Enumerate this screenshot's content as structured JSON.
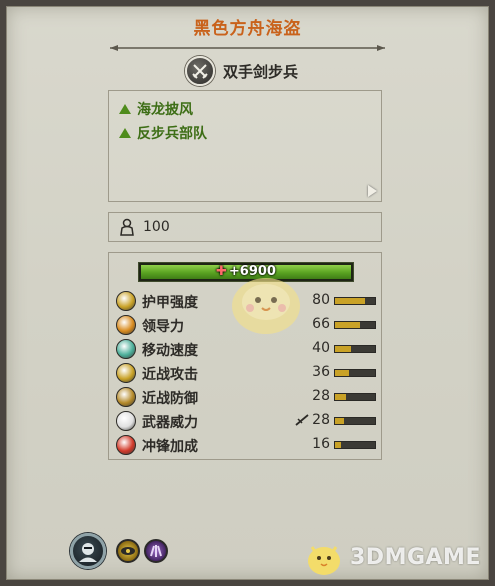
{
  "faction_title": "黑色方舟海盗",
  "unit": {
    "name": "双手剑步兵",
    "icon": "crossed-swords-icon"
  },
  "abilities": [
    {
      "label": "海龙披风",
      "icon": "green-triangle-icon"
    },
    {
      "label": "反步兵部队",
      "icon": "green-triangle-icon"
    }
  ],
  "men": {
    "count": "100",
    "icon": "soldier-icon"
  },
  "health": {
    "label": "+6900",
    "fraction": 1.0
  },
  "stats": [
    {
      "label": "护甲强度",
      "value": "80",
      "fill": 0.75,
      "icon": "armor-icon",
      "color": "#c9a227"
    },
    {
      "label": "领导力",
      "value": "66",
      "fill": 0.62,
      "icon": "leadership-icon",
      "color": "#d98b1e"
    },
    {
      "label": "移动速度",
      "value": "40",
      "fill": 0.4,
      "icon": "speed-icon",
      "color": "#4caf9a"
    },
    {
      "label": "近战攻击",
      "value": "36",
      "fill": 0.35,
      "icon": "melee-attack-icon",
      "color": "#c9a227"
    },
    {
      "label": "近战防御",
      "value": "28",
      "fill": 0.28,
      "icon": "melee-defence-icon",
      "color": "#b58a2a"
    },
    {
      "label": "武器威力",
      "value": "28",
      "fill": 0.22,
      "icon": "weapon-strength-icon",
      "color": "#e0e0e0",
      "marker": "armour-piercing-icon"
    },
    {
      "label": "冲锋加成",
      "value": "16",
      "fill": 0.15,
      "icon": "charge-bonus-icon",
      "color": "#d23a2a"
    }
  ],
  "footer": {
    "portrait_icon": "commander-portrait-icon",
    "traits": [
      {
        "icon": "eye-icon",
        "color": "#c9a227"
      },
      {
        "icon": "purple-claw-icon",
        "color": "#6a3d9a"
      }
    ]
  },
  "watermark": {
    "text": "3DMGAME"
  }
}
